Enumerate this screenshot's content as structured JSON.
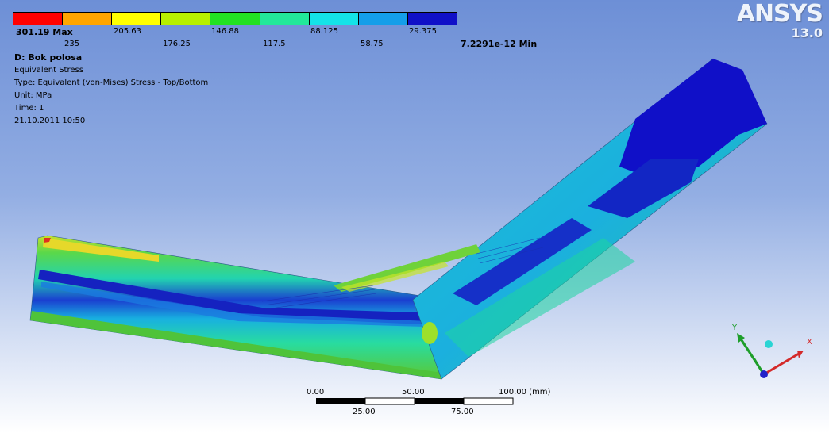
{
  "legend": {
    "colors": [
      "#ff0000",
      "#ffa500",
      "#ffff00",
      "#b7f000",
      "#23e123",
      "#22e89a",
      "#14e3e8",
      "#149ee9",
      "#1010c8"
    ],
    "labels_top": {
      "max": "301.19 Max",
      "l1": "205.63",
      "l2": "146.88",
      "l3": "88.125",
      "l4": "29.375"
    },
    "labels_bottom": {
      "b1": "235",
      "b2": "176.25",
      "b3": "117.5",
      "b4": "58.75",
      "min": "7.2291e-12 Min"
    }
  },
  "info": {
    "title": "D: Bok polosa",
    "result": "Equivalent Stress",
    "type": "Type: Equivalent (von-Mises) Stress - Top/Bottom",
    "unit": "Unit: MPa",
    "time": "Time: 1",
    "date": "21.10.2011 10:50"
  },
  "logo": {
    "brand": "ANSYS",
    "version": "13.0"
  },
  "scale_bar": {
    "top_labels": [
      "0.00",
      "50.00",
      "100.00 (mm)"
    ],
    "bottom_labels": [
      "25.00",
      "75.00"
    ]
  },
  "triad": {
    "x": "X",
    "y": "Y"
  }
}
